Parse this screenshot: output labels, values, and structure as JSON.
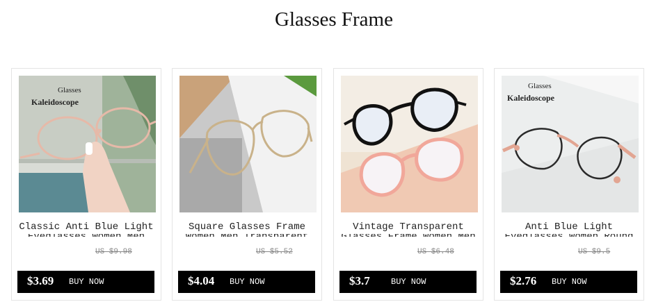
{
  "page": {
    "title": "Glasses Frame"
  },
  "products": [
    {
      "name": "Classic Anti Blue Light",
      "name_line2": "Eyeglasses Women Men",
      "old_price": "US $9.98",
      "price": "$3.69",
      "buy_label": "BUY NOW",
      "brand_logo": "Glasses Kaleidoscope"
    },
    {
      "name": "Square Glasses Frame",
      "name_line2": "Women Men Transparent",
      "old_price": "US $5.52",
      "price": "$4.04",
      "buy_label": "BUY NOW"
    },
    {
      "name": "Vintage Transparent",
      "name_line2": "Glasses Frame Women Men",
      "old_price": "US $6.48",
      "price": "$3.7",
      "buy_label": "BUY NOW"
    },
    {
      "name": "Anti Blue Light",
      "name_line2": "Eyeglasses Women Round",
      "old_price": "US $9.5",
      "price": "$2.76",
      "buy_label": "BUY NOW",
      "brand_logo": "Glasses Kaleidoscope"
    }
  ]
}
